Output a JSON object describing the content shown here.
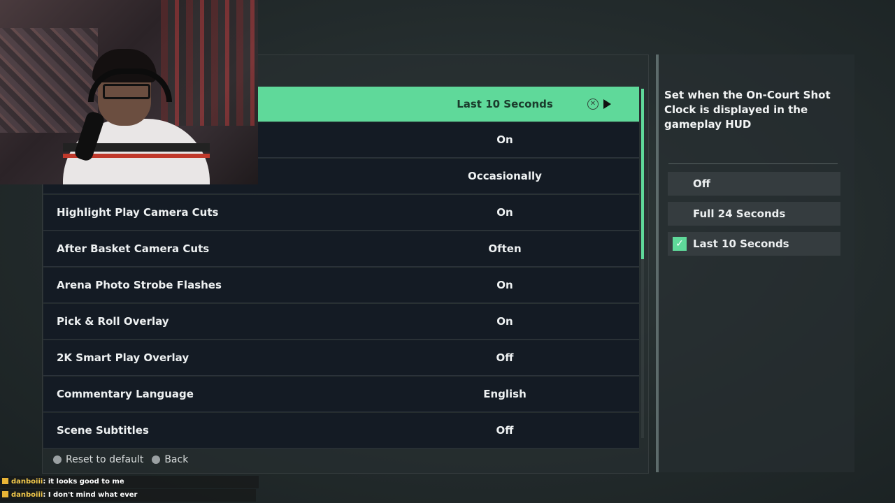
{
  "settings": {
    "rows": [
      {
        "label": "",
        "value": "Last 10 Seconds",
        "selected": true
      },
      {
        "label": "",
        "value": "On"
      },
      {
        "label": "",
        "value": "Occasionally"
      },
      {
        "label": "Highlight Play Camera Cuts",
        "value": "On"
      },
      {
        "label": "After Basket Camera Cuts",
        "value": "Often"
      },
      {
        "label": "Arena Photo Strobe Flashes",
        "value": "On"
      },
      {
        "label": "Pick & Roll Overlay",
        "value": "On"
      },
      {
        "label": "2K Smart Play Overlay",
        "value": "Off"
      },
      {
        "label": "Commentary Language",
        "value": "English"
      },
      {
        "label": "Scene Subtitles",
        "value": "Off"
      }
    ]
  },
  "footer": {
    "reset_label": "Reset to default",
    "back_label": "Back"
  },
  "side": {
    "description": "Set when the On-Court Shot Clock is displayed in the gameplay HUD",
    "options": [
      {
        "label": "Off",
        "checked": false
      },
      {
        "label": "Full 24 Seconds",
        "checked": false
      },
      {
        "label": "Last 10 Seconds",
        "checked": true
      }
    ]
  },
  "chat": {
    "messages": [
      {
        "user": "danboiii",
        "text": ": it looks good to me"
      },
      {
        "user": "danboiii",
        "text": ": I don't mind what ever"
      }
    ]
  },
  "colors": {
    "accent": "#5fd99a",
    "row_bg": "#141b24",
    "option_bg": "#353c3f"
  },
  "icons": {
    "confirm": "circle-x-icon",
    "next": "arrow-right-icon",
    "check": "checkmark-icon",
    "chat_badge": "subscriber-badge-icon"
  }
}
